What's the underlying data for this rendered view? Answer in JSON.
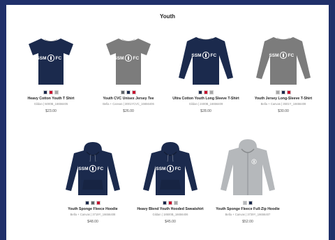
{
  "section": {
    "title": "Youth"
  },
  "colors": {
    "frame": "#20306a",
    "navy": "#1b2a4d",
    "red": "#c8102e",
    "gray": "#a8a8a8",
    "darkgray": "#5f6469",
    "heather": "#7c7c7c",
    "lightheather": "#b5b8bb"
  },
  "products": [
    {
      "name": "Heavy Cotton Youth T Shirt",
      "sku": "Gildan | 5000B_16656405",
      "price": "$23.00",
      "garment": "tee",
      "garment_color": "#1b2a4d",
      "logo_color": "#ffffff",
      "swatches": [
        "#1b2a4d",
        "#c8102e",
        "#a8a8a8"
      ]
    },
    {
      "name": "Youth CVC Unisex Jersey Tee",
      "sku": "Bella + Canvas | 3001YCVC_16656406",
      "price": "$26.00",
      "garment": "tee",
      "garment_color": "#7c7c7c",
      "logo_color": "#ffffff",
      "swatches": [
        "#5f6469",
        "#1b2a4d",
        "#c8102e"
      ]
    },
    {
      "name": "Ultra Cotton Youth Long Sleeve T-Shirt",
      "sku": "Gildan | 2400B_16656409",
      "price": "$28.00",
      "garment": "longsleeve",
      "garment_color": "#1b2a4d",
      "logo_color": "#ffffff",
      "swatches": [
        "#1b2a4d",
        "#c8102e",
        "#a8a8a8"
      ]
    },
    {
      "name": "Youth Jersey Long-Sleeve T-Shirt",
      "sku": "Bella + Canvas | 3501Y_16656408",
      "price": "$30.00",
      "garment": "longsleeve",
      "garment_color": "#7c7c7c",
      "logo_color": "#ffffff",
      "swatches": [
        "#a8a8a8",
        "#1b2a4d",
        "#c8102e"
      ]
    },
    {
      "name": "Youth Sponge Fleece Hoodie",
      "sku": "Bella + Canvas | 3719Y_16656408",
      "price": "$48.00",
      "garment": "hoodie",
      "garment_color": "#1b2a4d",
      "logo_color": "#ffffff",
      "swatches": [
        "#1b2a4d",
        "#5f6469",
        "#c8102e"
      ]
    },
    {
      "name": "Heavy Blend Youth Hooded Sweatshirt",
      "sku": "Gildan | 18500B_16656406",
      "price": "$45.00",
      "garment": "hoodie",
      "garment_color": "#1b2a4d",
      "logo_color": "#ffffff",
      "swatches": [
        "#1b2a4d",
        "#c8102e",
        "#a8a8a8"
      ]
    },
    {
      "name": "Youth Sponge Fleece Full-Zip Hoodie",
      "sku": "Bella + Canvas | 3739Y_16656407",
      "price": "$52.00",
      "garment": "zip",
      "garment_color": "#b5b8bb",
      "logo_color": "#ffffff",
      "swatches": [
        "#b5b8bb",
        "#1b2a4d"
      ]
    }
  ],
  "logo": {
    "left": "SSM",
    "right": "FC"
  }
}
